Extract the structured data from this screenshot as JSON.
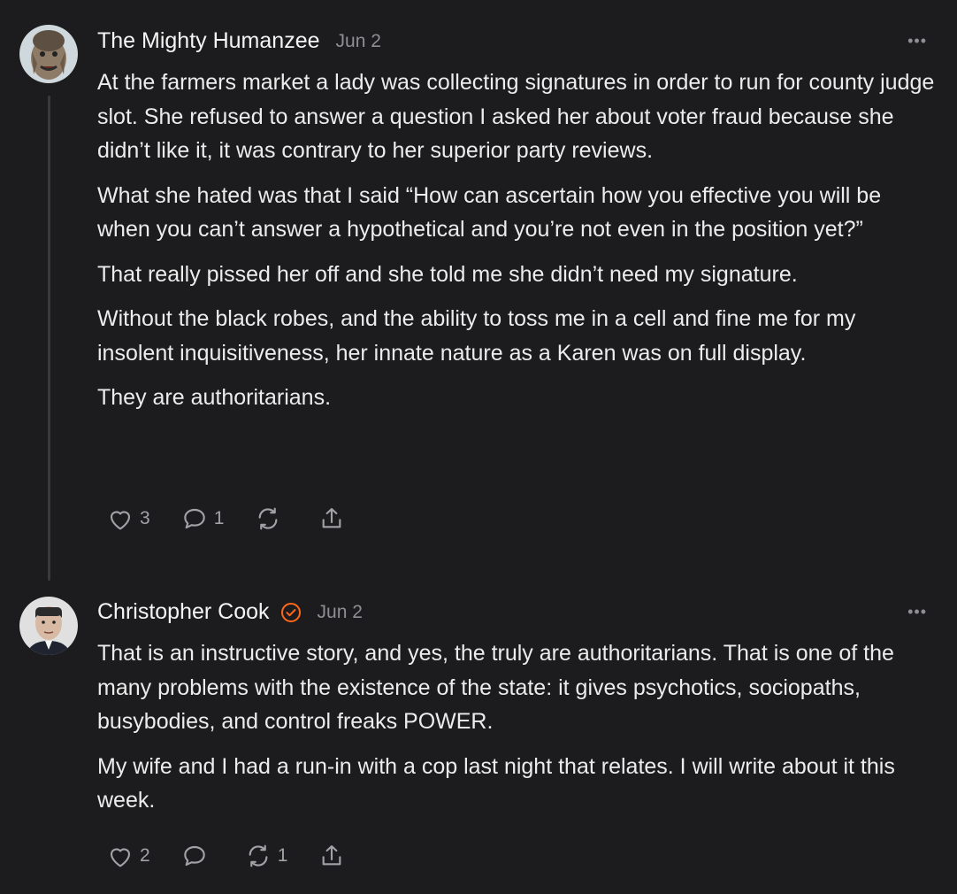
{
  "comments": [
    {
      "author": "The Mighty Humanzee",
      "date": "Jun 2",
      "verified": false,
      "paragraphs": [
        "At the farmers market a lady was collecting signatures in order to run for county judge slot. She refused to answer a question I asked her about voter fraud because she didn’t like it, it was contrary to her superior party reviews.",
        "What she hated was that I said “How can ascertain how you effective you will be when you can’t answer a hypothetical and you’re not even in the position yet?”",
        "That really pissed her off and she told me she didn’t need my signature.",
        "Without the black robes, and the ability to toss me in a cell and fine me for my insolent inquisitiveness, her innate nature as a Karen was on full display.",
        "They are authoritarians."
      ],
      "likes": "3",
      "replies": "1",
      "restacks": "",
      "more_icon": "ellipsis-icon"
    },
    {
      "author": "Christopher Cook",
      "date": "Jun 2",
      "verified": true,
      "paragraphs": [
        "That is an instructive story, and yes, the truly are authoritarians. That is one of the many problems with the existence of the state: it gives psychotics, sociopaths, busybodies, and control freaks POWER.",
        "My wife and I had a run-in with a cop last night that relates. I will write about it this week."
      ],
      "likes": "2",
      "replies": "",
      "restacks": "1",
      "more_icon": "ellipsis-icon"
    }
  ],
  "colors": {
    "background": "#1c1c1e",
    "text": "#ececec",
    "muted": "#8e8e93",
    "verified_accent": "#ff6719",
    "thread_line": "#3a3a3d"
  }
}
